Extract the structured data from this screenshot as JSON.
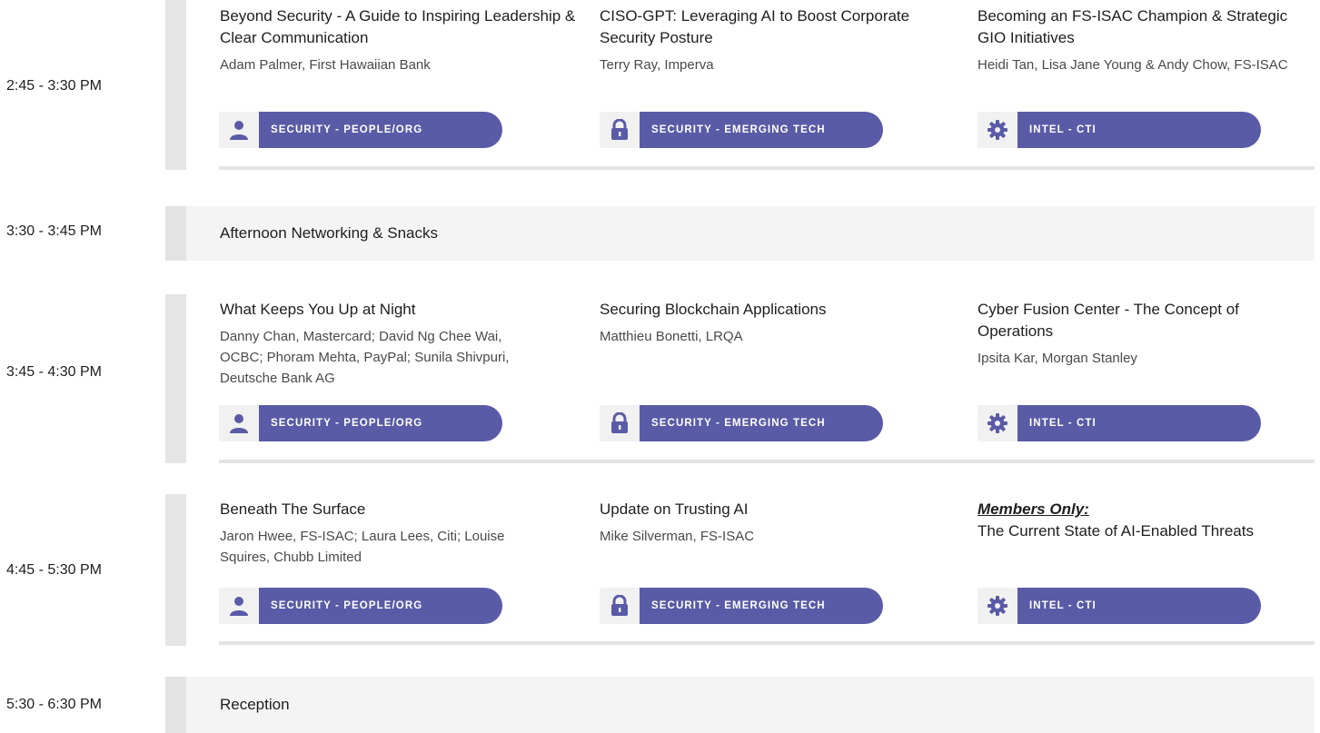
{
  "colors": {
    "accent": "#5a5ba6",
    "bar": "#e5e5e5",
    "band": "#f4f4f4"
  },
  "tracks": {
    "people": {
      "label": "SECURITY - PEOPLE/ORG",
      "icon": "person-icon"
    },
    "tech": {
      "label": "SECURITY - EMERGING TECH",
      "icon": "lock-icon"
    },
    "intel": {
      "label": "INTEL - CTI",
      "icon": "gear-icon"
    }
  },
  "rows": [
    {
      "time": "2:45 - 3:30 PM",
      "sessions": [
        {
          "title": "Beyond Security - A Guide to Inspiring Leadership & Clear Communication",
          "speakers": "Adam Palmer, First Hawaiian Bank"
        },
        {
          "title": "CISO-GPT: Leveraging AI to Boost Corporate Security Posture",
          "speakers": "Terry Ray, Imperva"
        },
        {
          "title": "Becoming an FS-ISAC Champion & Strategic GIO Initiatives",
          "speakers": "Heidi Tan, Lisa Jane Young & Andy Chow, FS-ISAC"
        }
      ]
    },
    {
      "time": "3:30 - 3:45 PM",
      "break_title": "Afternoon Networking & Snacks"
    },
    {
      "time": "3:45 - 4:30 PM",
      "sessions": [
        {
          "title": "What Keeps You Up at Night",
          "speakers": "Danny Chan, Mastercard; David Ng Chee Wai, OCBC; Phoram Mehta, PayPal; Sunila Shivpuri, Deutsche Bank AG"
        },
        {
          "title": "Securing Blockchain Applications",
          "speakers": "Matthieu Bonetti, LRQA"
        },
        {
          "title": "Cyber Fusion Center - The Concept of Operations",
          "speakers": "Ipsita Kar, Morgan Stanley"
        }
      ]
    },
    {
      "time": "4:45 - 5:30 PM",
      "sessions": [
        {
          "title": "Beneath The Surface",
          "speakers": "Jaron Hwee, FS-ISAC; Laura Lees, Citi; Louise Squires, Chubb Limited"
        },
        {
          "title": "Update on Trusting AI",
          "speakers": "Mike Silverman, FS-ISAC"
        },
        {
          "members_label": "Members Only:",
          "title": "The Current State of AI-Enabled Threats"
        }
      ]
    },
    {
      "time": "5:30 - 6:30 PM",
      "break_title": "Reception"
    }
  ]
}
